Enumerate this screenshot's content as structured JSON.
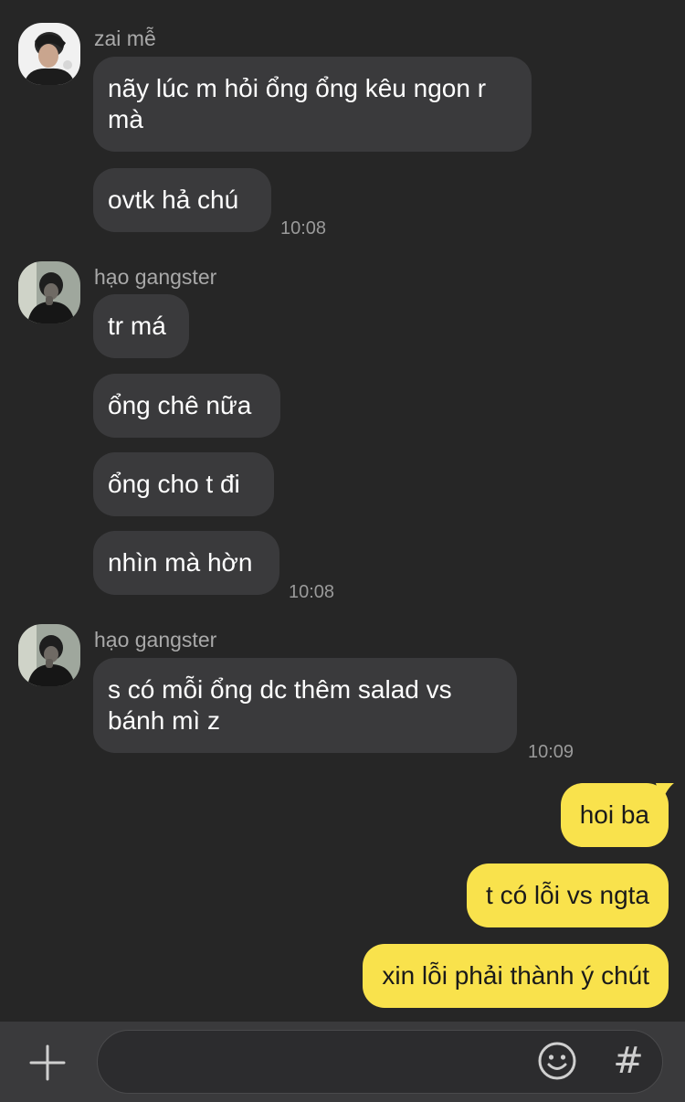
{
  "groups": [
    {
      "sender": "zai mễ",
      "messages": [
        "nãy lúc m hỏi ổng ổng kêu ngon r mà",
        "ovtk hả chú"
      ],
      "time": "10:08"
    },
    {
      "sender": "hạo gangster",
      "messages": [
        "tr má",
        "ổng chê nữa",
        "ổng cho t đi",
        "nhìn mà hờn"
      ],
      "time": "10:08"
    },
    {
      "sender": "hạo gangster",
      "messages": [
        "s có mỗi ổng dc thêm salad vs bánh mì z"
      ],
      "time": "10:09"
    }
  ],
  "outgoing": [
    "hoi ba",
    "t có lỗi vs ngta",
    "xin lỗi phải thành ý chút"
  ],
  "composer": {
    "placeholder": "",
    "hash_label": "#",
    "icons": [
      "plus-icon",
      "emoji-icon",
      "hashtag-icon"
    ]
  },
  "colors": {
    "background": "#262626",
    "incoming_bubble": "#3a3a3c",
    "outgoing_bubble": "#f9e24c"
  }
}
